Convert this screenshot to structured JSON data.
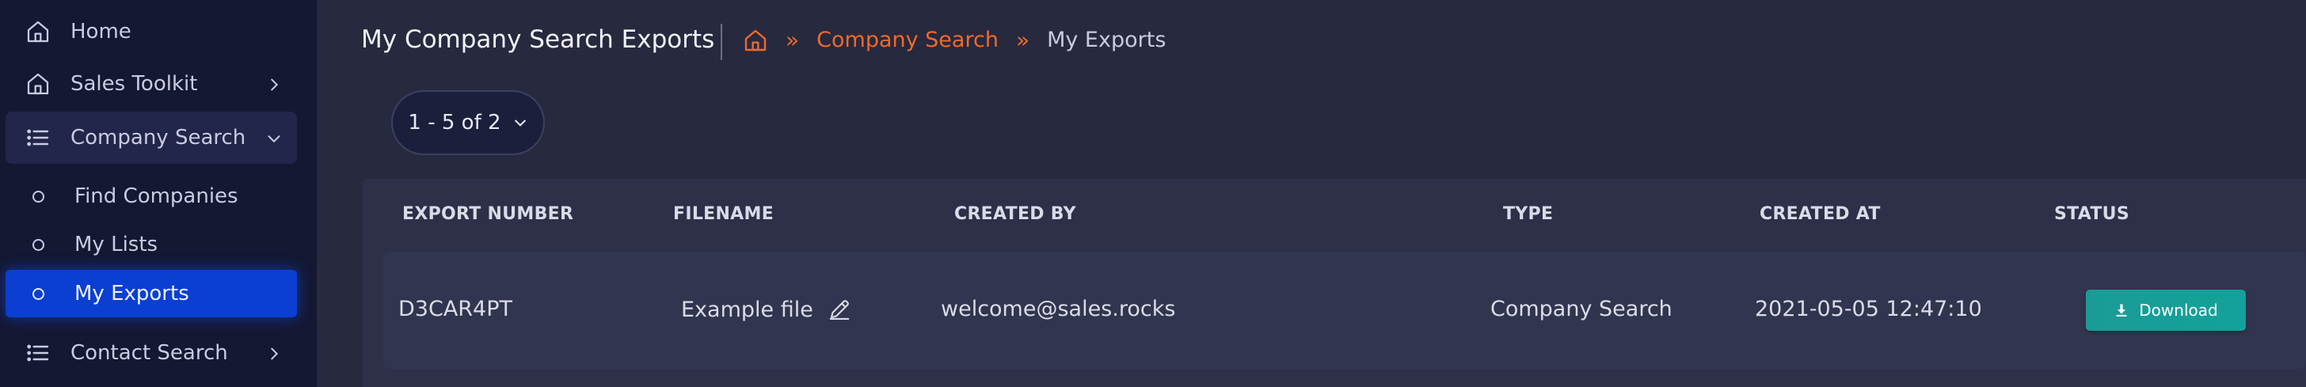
{
  "sidebar": {
    "items": [
      {
        "label": "Home",
        "icon": "home-icon"
      },
      {
        "label": "Sales Toolkit",
        "icon": "home-icon"
      },
      {
        "label": "Company Search",
        "icon": "list-icon",
        "expanded": true,
        "children": [
          {
            "label": "Find Companies"
          },
          {
            "label": "My Lists"
          },
          {
            "label": "My Exports",
            "active": true
          }
        ]
      },
      {
        "label": "Contact Search",
        "icon": "list-icon"
      }
    ]
  },
  "header": {
    "title": "My Company Search Exports",
    "breadcrumb": {
      "home_icon": "home-icon",
      "separator": "»",
      "link": "Company Search",
      "current": "My Exports"
    }
  },
  "pager": {
    "label": "1 - 5 of 2"
  },
  "table": {
    "columns": [
      "EXPORT NUMBER",
      "FILENAME",
      "CREATED BY",
      "TYPE",
      "CREATED AT",
      "STATUS"
    ],
    "rows": [
      {
        "export_number": "D3CAR4PT",
        "filename": "Example file",
        "created_by": "welcome@sales.rocks",
        "type": "Company Search",
        "created_at": "2021-05-05 12:47:10",
        "status_button": "Download"
      }
    ]
  },
  "colors": {
    "accent_orange": "#ee6a2c",
    "active_blue": "#0a3fd1",
    "download_teal": "#15a09a",
    "sidebar_bg": "#141833",
    "content_bg": "#27293f"
  }
}
